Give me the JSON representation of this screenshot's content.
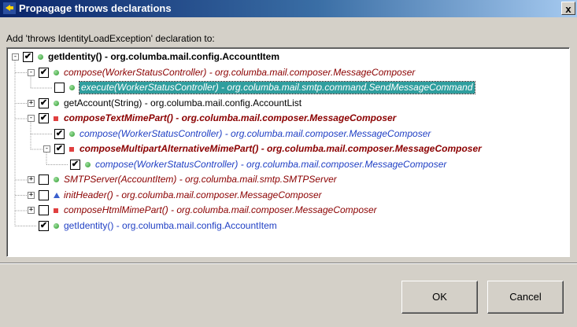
{
  "window": {
    "title": "Propagage throws declarations",
    "close_label": "x"
  },
  "caption": "Add 'throws IdentityLoadException' declaration to:",
  "tree": [
    {
      "level": 0,
      "expander": "-",
      "checked": true,
      "icon": "green",
      "color": "black",
      "bold": true,
      "italic": false,
      "selected": false,
      "label": "getIdentity() - org.columba.mail.config.AccountItem"
    },
    {
      "level": 1,
      "expander": "-",
      "checked": true,
      "icon": "green",
      "color": "red",
      "bold": false,
      "italic": true,
      "selected": false,
      "label": "compose(WorkerStatusController) - org.columba.mail.composer.MessageComposer"
    },
    {
      "level": 2,
      "expander": "",
      "checked": false,
      "icon": "green",
      "color": "blue",
      "bold": false,
      "italic": true,
      "selected": true,
      "label": "execute(WorkerStatusController) - org.columba.mail.smtp.command.SendMessageCommand"
    },
    {
      "level": 1,
      "expander": "+",
      "checked": true,
      "icon": "green",
      "color": "black",
      "bold": false,
      "italic": false,
      "selected": false,
      "label": "getAccount(String) - org.columba.mail.config.AccountList"
    },
    {
      "level": 1,
      "expander": "-",
      "checked": true,
      "icon": "red",
      "color": "red",
      "bold": true,
      "italic": true,
      "selected": false,
      "label": "composeTextMimePart() - org.columba.mail.composer.MessageComposer"
    },
    {
      "level": 2,
      "expander": "",
      "checked": true,
      "icon": "green",
      "color": "blue",
      "bold": false,
      "italic": true,
      "selected": false,
      "label": "compose(WorkerStatusController) - org.columba.mail.composer.MessageComposer"
    },
    {
      "level": 2,
      "expander": "-",
      "checked": true,
      "icon": "red",
      "color": "red",
      "bold": true,
      "italic": true,
      "selected": false,
      "label": "composeMultipartAlternativeMimePart() - org.columba.mail.composer.MessageComposer"
    },
    {
      "level": 3,
      "expander": "",
      "checked": true,
      "icon": "green",
      "color": "blue",
      "bold": false,
      "italic": true,
      "selected": false,
      "label": "compose(WorkerStatusController) - org.columba.mail.composer.MessageComposer"
    },
    {
      "level": 1,
      "expander": "+",
      "checked": false,
      "icon": "green",
      "color": "red",
      "bold": false,
      "italic": true,
      "selected": false,
      "label": "SMTPServer(AccountItem) - org.columba.mail.smtp.SMTPServer"
    },
    {
      "level": 1,
      "expander": "+",
      "checked": false,
      "icon": "blue",
      "color": "red",
      "bold": false,
      "italic": true,
      "selected": false,
      "label": "initHeader() - org.columba.mail.composer.MessageComposer"
    },
    {
      "level": 1,
      "expander": "+",
      "checked": false,
      "icon": "red",
      "color": "red",
      "bold": false,
      "italic": true,
      "selected": false,
      "label": "composeHtmlMimePart() - org.columba.mail.composer.MessageComposer"
    },
    {
      "level": 1,
      "expander": "",
      "checked": true,
      "icon": "green",
      "color": "blue",
      "bold": false,
      "italic": false,
      "selected": false,
      "label": "getIdentity() - org.columba.mail.config.AccountItem"
    }
  ],
  "buttons": {
    "ok_label": "OK",
    "cancel_label": "Cancel"
  }
}
